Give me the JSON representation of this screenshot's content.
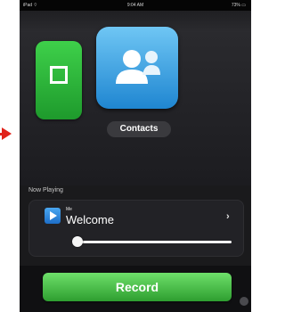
{
  "status_bar": {
    "carrier": "iPad ⌔",
    "time": "9:04 AM",
    "battery": "73% ▭"
  },
  "apps": [
    {
      "id": "green-app",
      "color": "#2fb53a"
    },
    {
      "id": "contacts",
      "label": "Contacts",
      "color": "#3aa3e6"
    }
  ],
  "now_playing": {
    "section_label": "Now Playing",
    "artist": "Me",
    "track": "Welcome",
    "chevron": "›",
    "progress": 0.0
  },
  "record_button": {
    "label": "Record",
    "color": "#3cb13a"
  },
  "arrow_color": "#e0231b"
}
